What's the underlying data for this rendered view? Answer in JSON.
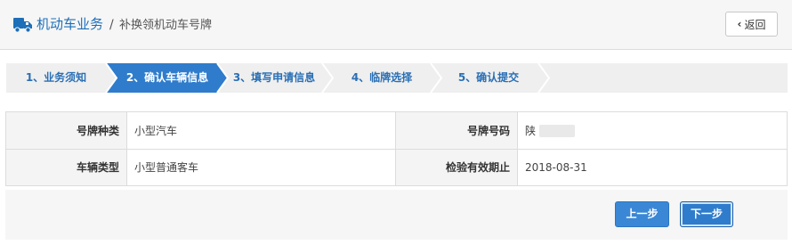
{
  "header": {
    "title": "机动车业务",
    "separator": "/",
    "subtitle": "补换领机动车号牌",
    "back_label": "返回",
    "brand_color": "#1d6fb8",
    "icon": "truck-icon"
  },
  "steps": [
    {
      "label": "1、业务须知",
      "active": false
    },
    {
      "label": "2、确认车辆信息",
      "active": true
    },
    {
      "label": "3、填写申请信息",
      "active": false
    },
    {
      "label": "4、临牌选择",
      "active": false
    },
    {
      "label": "5、确认提交",
      "active": false
    }
  ],
  "vehicle_info": {
    "plate_type_label": "号牌种类",
    "plate_type_value": "小型汽车",
    "plate_number_label": "号牌号码",
    "plate_number_value": "陕",
    "vehicle_type_label": "车辆类型",
    "vehicle_type_value": "小型普通客车",
    "inspection_label": "检验有效期止",
    "inspection_value": "2018-08-31"
  },
  "actions": {
    "prev_label": "上一步",
    "next_label": "下一步"
  },
  "colors": {
    "active_step": "#2f7ccc",
    "button": "#3a87d6"
  }
}
